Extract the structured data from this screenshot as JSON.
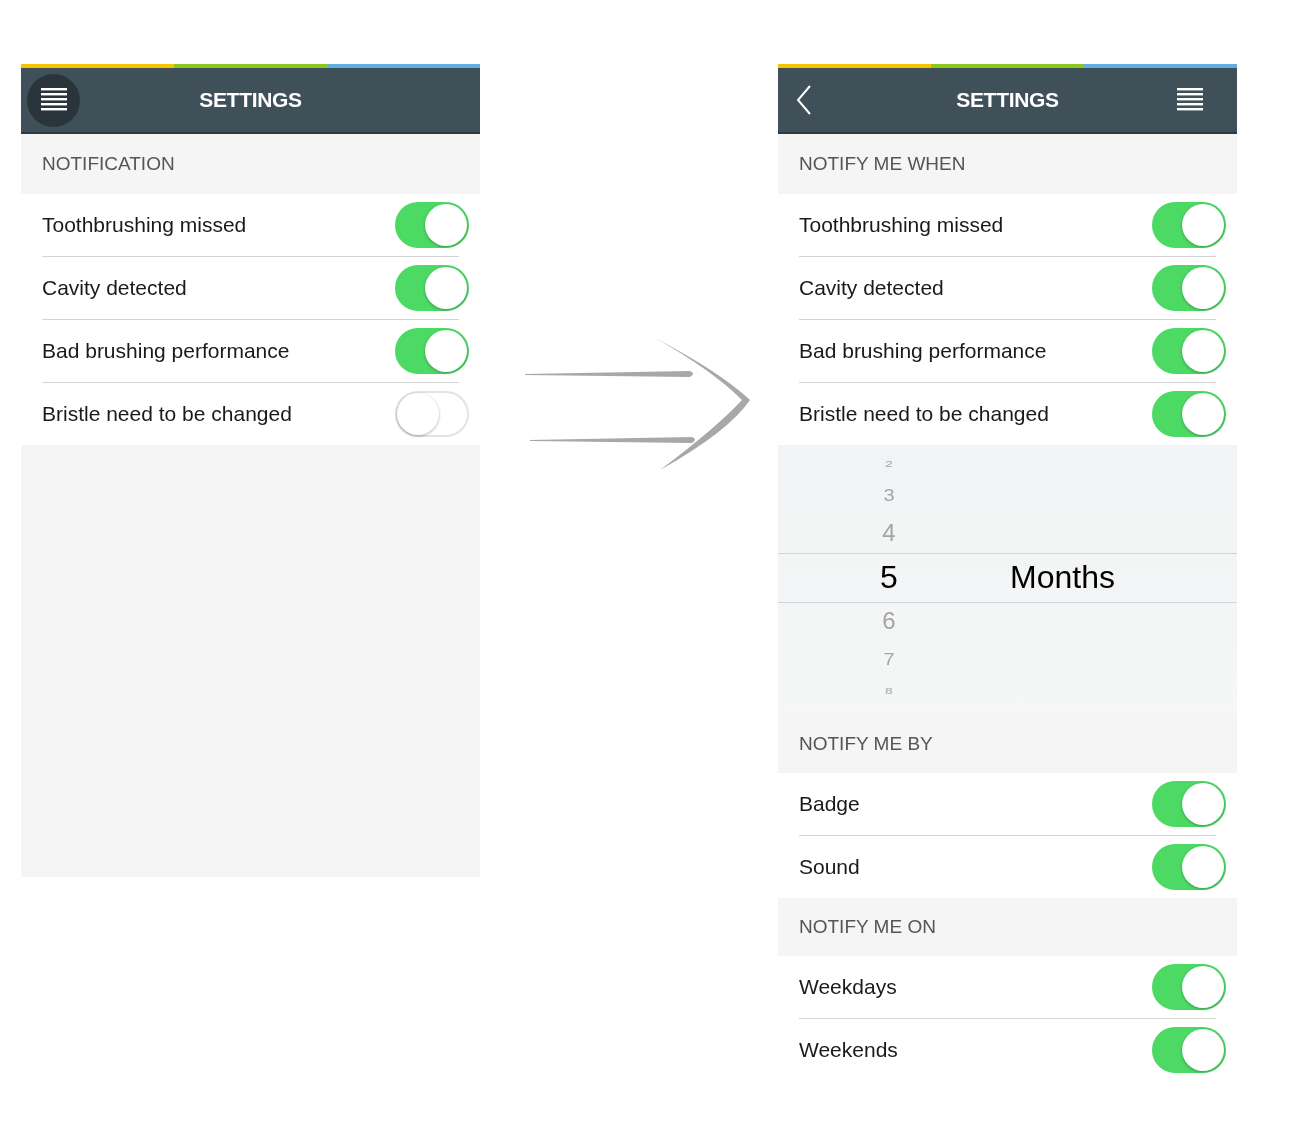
{
  "screens": [
    {
      "header": {
        "title": "SETTINGS",
        "left": {
          "kind": "menu"
        }
      },
      "sections": [
        {
          "kind": "toggles",
          "title": "NOTIFICATION",
          "rows": [
            {
              "label": "Toothbrushing missed",
              "on": true
            },
            {
              "label": "Cavity detected",
              "on": true
            },
            {
              "label": "Bad brushing performance",
              "on": true
            },
            {
              "label": "Bristle need to be changed",
              "on": false
            }
          ]
        }
      ]
    },
    {
      "header": {
        "title": "SETTINGS",
        "left": {
          "kind": "back"
        },
        "right": {
          "kind": "menu"
        }
      },
      "sections": [
        {
          "kind": "toggles",
          "title": "NOTIFY ME WHEN",
          "rows": [
            {
              "label": "Toothbrushing missed",
              "on": true
            },
            {
              "label": "Cavity detected",
              "on": true
            },
            {
              "label": "Bad brushing performance",
              "on": true
            },
            {
              "label": "Bristle need to be changed",
              "on": true
            }
          ]
        },
        {
          "kind": "picker",
          "unit": "Months",
          "values": [
            {
              "label": "2",
              "selected": false
            },
            {
              "label": "3",
              "selected": false
            },
            {
              "label": "4",
              "selected": false
            },
            {
              "label": "5",
              "selected": true
            },
            {
              "label": "6",
              "selected": false
            },
            {
              "label": "7",
              "selected": false
            },
            {
              "label": "8",
              "selected": false
            }
          ]
        },
        {
          "kind": "toggles",
          "title": "NOTIFY ME BY",
          "rows": [
            {
              "label": "Badge",
              "on": true
            },
            {
              "label": "Sound",
              "on": true
            }
          ]
        },
        {
          "kind": "toggles",
          "title": "NOTIFY ME ON",
          "rows": [
            {
              "label": "Weekdays",
              "on": true
            },
            {
              "label": "Weekends",
              "on": true
            }
          ]
        }
      ]
    }
  ]
}
